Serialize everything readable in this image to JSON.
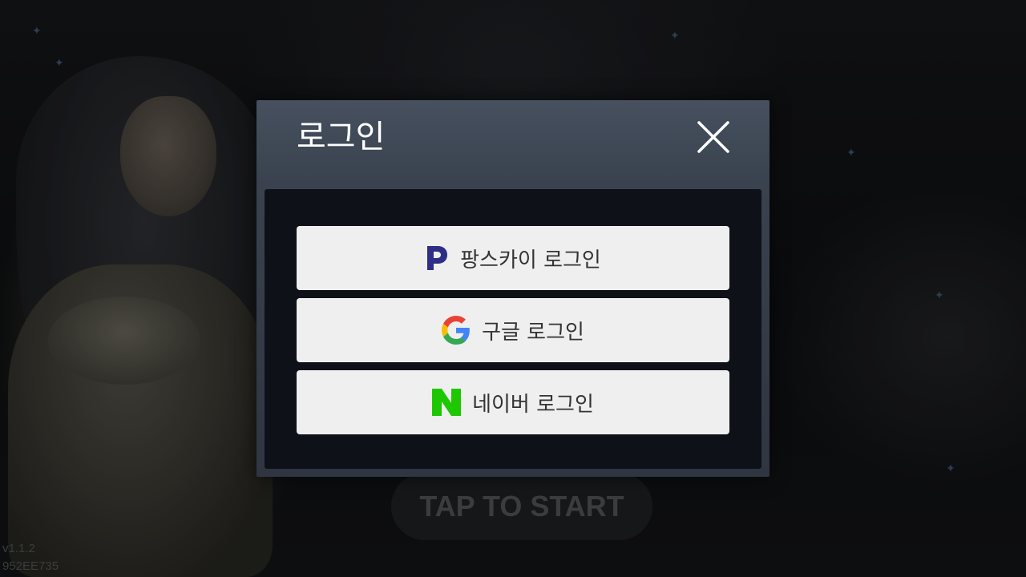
{
  "dialog": {
    "title": "로그인",
    "buttons": [
      {
        "label": "팡스카이 로그인",
        "icon": "pangsky-p-icon"
      },
      {
        "label": "구글 로그인",
        "icon": "google-g-icon"
      },
      {
        "label": "네이버 로그인",
        "icon": "naver-n-icon"
      }
    ]
  },
  "background": {
    "tap_to_start": "TAP TO START",
    "version": "v1.1.2",
    "build_id": "952EE735"
  },
  "colors": {
    "pangsky": "#2d2f86",
    "naver": "#1ec800",
    "button_bg": "#efefef"
  }
}
